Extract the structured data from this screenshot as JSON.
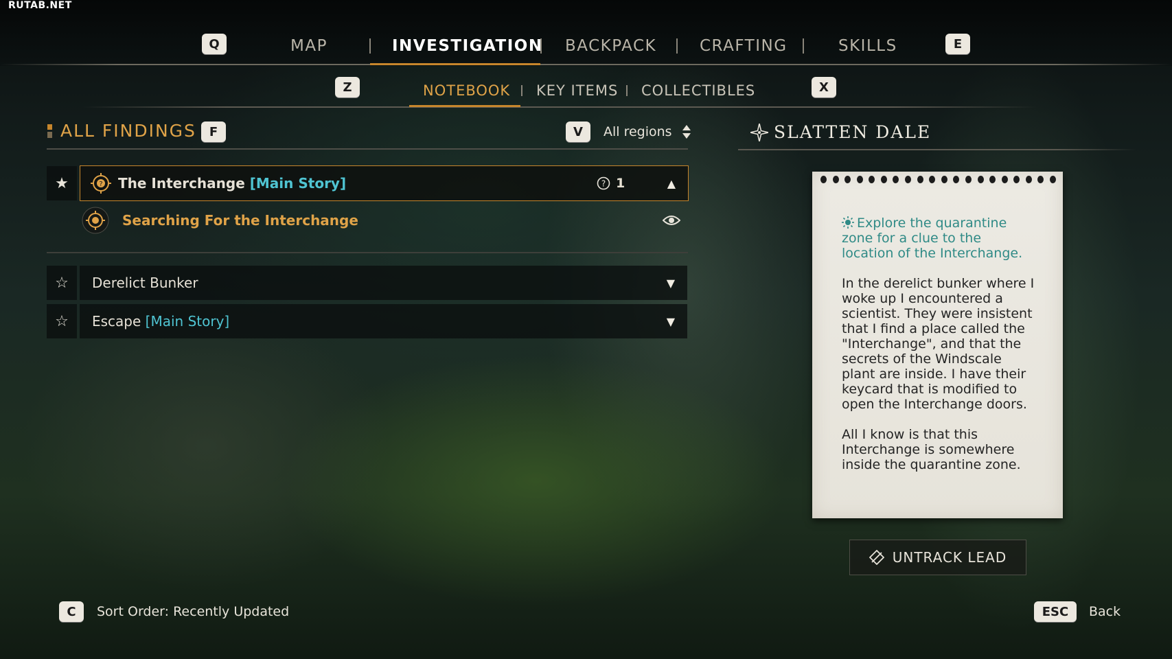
{
  "watermark": "RUTAB.NET",
  "nav": {
    "prev_key": "Q",
    "next_key": "E",
    "tabs": [
      {
        "label": "MAP"
      },
      {
        "label": "INVESTIGATION"
      },
      {
        "label": "BACKPACK"
      },
      {
        "label": "CRAFTING"
      },
      {
        "label": "SKILLS"
      }
    ],
    "active_tab": "INVESTIGATION"
  },
  "subnav": {
    "prev_key": "Z",
    "next_key": "X",
    "tabs": [
      {
        "label": "NOTEBOOK"
      },
      {
        "label": "KEY ITEMS"
      },
      {
        "label": "COLLECTIBLES"
      }
    ],
    "active_tab": "NOTEBOOK"
  },
  "findings": {
    "title": "ALL FINDINGS",
    "filter_key": "F",
    "region_key": "V",
    "region_value": "All regions",
    "items": [
      {
        "name": "The Interchange",
        "tag": "[Main Story]",
        "count": "1",
        "starred": true,
        "expanded": true,
        "leads": [
          {
            "label": "Searching For the Interchange"
          }
        ]
      },
      {
        "name": "Derelict Bunker",
        "tag": "",
        "starred": false,
        "expanded": false
      },
      {
        "name": "Escape",
        "tag": "[Main Story]",
        "starred": false,
        "expanded": false
      }
    ]
  },
  "detail": {
    "region_title": "SLATTEN DALE",
    "objective": "Explore the quarantine zone for a clue to the location of the Interchange.",
    "paragraph1": "In the derelict bunker where I\nwoke up I encountered a\nscientist. They were insistent\nthat I find a place called the\n\"Interchange\", and that the\nsecrets of the Windscale\nplant are inside. I have their\nkeycard that is modified to\nopen the Interchange doors.",
    "paragraph2": "All I know is that this\nInterchange is somewhere\ninside the quarantine zone.",
    "untrack_label": "UNTRACK LEAD"
  },
  "footer": {
    "sort_key": "C",
    "sort_label": "Sort Order: Recently Updated",
    "back_key": "ESC",
    "back_label": "Back"
  },
  "colors": {
    "accent": "#c7862c",
    "tag": "#4fc4d2",
    "objective": "#2f8a86"
  }
}
